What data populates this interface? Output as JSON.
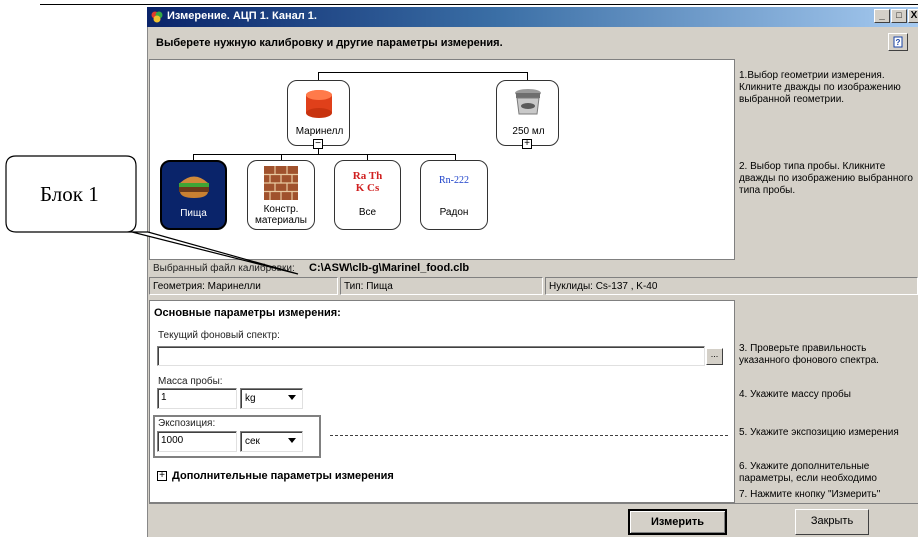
{
  "window": {
    "title": "Измерение. АЦП 1. Канал 1.",
    "controls": {
      "minimize": "_",
      "maximize": "□",
      "close": "X"
    }
  },
  "header": {
    "instruction": "Выберете нужную калибровку и другие параметры измерения.",
    "help_icon": "help-book-icon"
  },
  "tree": {
    "geometries": [
      {
        "label": "Маринелл",
        "icon": "marinelli-beaker-icon",
        "expander": "−"
      },
      {
        "label": "250 мл",
        "icon": "jar-250ml-icon",
        "expander": "+"
      }
    ],
    "sample_types": [
      {
        "label": "Пища",
        "icon": "burger-icon",
        "selected": true
      },
      {
        "label1": "Констр.",
        "label2": "материалы",
        "icon": "brick-wall-icon"
      },
      {
        "label": "Все",
        "icon_line1": "Ra Th",
        "icon_line2": "K  Cs"
      },
      {
        "label": "Радон",
        "icon_text": "Rn-222"
      }
    ]
  },
  "hints": {
    "step1": "1.Выбор геометрии измерения. Кликните дважды по изображению выбранной геометрии.",
    "step2": "2. Выбор типа пробы. Кликните дважды по изображению выбранного типа пробы.",
    "step3": "3. Проверьте правильность указанного фонового спектра.",
    "step4": "4. Укажите массу пробы",
    "step5": "5. Укажите экспозицию измерения",
    "step6": "6. Укажите дополнительные параметры, если необходимо",
    "step7": "7. Нажмите кнопку \"Измерить\""
  },
  "calibration": {
    "label": "Выбранный файл калибровки:",
    "file": "C:\\ASW\\clb-g\\Marinel_food.clb",
    "geometry": "Геометрия:  Маринелли",
    "type": "Тип:  Пища",
    "nuclides": "Нуклиды:  Cs-137 , K-40"
  },
  "params": {
    "title": "Основные параметры измерения:",
    "background_label": "Текущий фоновый спектр:",
    "background_value": "",
    "browse_label": "...",
    "mass_label": "Масса пробы:",
    "mass_value": "1",
    "mass_unit": "kg",
    "exposure_label": "Экспозиция:",
    "exposure_value": "1000",
    "exposure_unit": "сек",
    "additional_toggle": "+",
    "additional_label": "Дополнительные параметры измерения"
  },
  "buttons": {
    "measure": "Измерить",
    "close": "Закрыть"
  },
  "callout": {
    "text": "Блок 1"
  }
}
